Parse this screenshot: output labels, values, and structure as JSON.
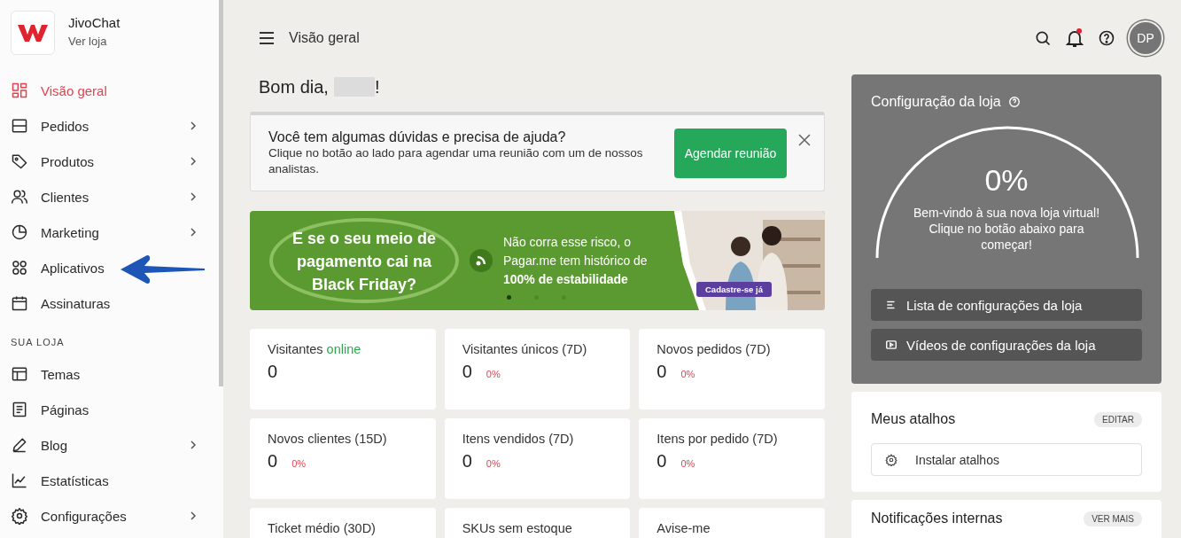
{
  "sidebar": {
    "store_name": "JivoChat",
    "store_link": "Ver loja",
    "items": [
      {
        "label": "Visão geral",
        "has_submenu": false,
        "selected": true
      },
      {
        "label": "Pedidos",
        "has_submenu": true,
        "selected": false
      },
      {
        "label": "Produtos",
        "has_submenu": true,
        "selected": false
      },
      {
        "label": "Clientes",
        "has_submenu": true,
        "selected": false
      },
      {
        "label": "Marketing",
        "has_submenu": true,
        "selected": false
      },
      {
        "label": "Aplicativos",
        "has_submenu": false,
        "selected": false
      },
      {
        "label": "Assinaturas",
        "has_submenu": false,
        "selected": false
      }
    ],
    "section_title": "SUA LOJA",
    "store_items": [
      {
        "label": "Temas",
        "has_submenu": false,
        "selected": false
      },
      {
        "label": "Páginas",
        "has_submenu": false,
        "selected": false
      },
      {
        "label": "Blog",
        "has_submenu": true,
        "selected": false
      },
      {
        "label": "Estatísticas",
        "has_submenu": false,
        "selected": false
      },
      {
        "label": "Configurações",
        "has_submenu": true,
        "selected": false
      }
    ]
  },
  "header": {
    "title": "Visão geral",
    "notification_dot": true,
    "avatar": "DP"
  },
  "greeting": {
    "text": "Bom dia,",
    "end": "!"
  },
  "help_banner": {
    "title": "Você tem algumas dúvidas e precisa de ajuda?",
    "text": "Clique no botão ao lado para agendar uma reunião com um de nossos analistas.",
    "button": "Agendar reunião"
  },
  "promo": {
    "headline": "E se o seu meio de pagamento cai na Black Friday?",
    "text": "Não corra esse risco, o Pagar.me tem histórico de **100% de estabilidade**",
    "cta": "Cadastre-se já",
    "slides": [
      {
        "selected": true
      },
      {
        "selected": false
      },
      {
        "selected": false
      }
    ]
  },
  "stats": [
    {
      "label": "Visitantes",
      "highlight": "online",
      "value": "0"
    },
    {
      "label": "Visitantes únicos (7D)",
      "value": "0",
      "change": "0%"
    },
    {
      "label": "Novos pedidos (7D)",
      "value": "0",
      "change": "0%"
    },
    {
      "label": "Novos clientes (15D)",
      "value": "0",
      "change": "0%"
    },
    {
      "label": "Itens vendidos (7D)",
      "value": "0",
      "change": "0%"
    },
    {
      "label": "Itens por pedido (7D)",
      "value": "0",
      "change": "0%"
    },
    {
      "label": "Ticket médio (30D)"
    },
    {
      "label": "SKUs sem estoque"
    },
    {
      "label": "Avise-me"
    }
  ],
  "setup": {
    "title": "Configuração da loja",
    "percent": "0%",
    "message": "Bem-vindo à sua nova loja virtual! Clique no botão abaixo para começar!",
    "buttons": [
      {
        "label": "Lista de configurações da loja"
      },
      {
        "label": "Vídeos de configurações da loja"
      }
    ]
  },
  "shortcuts": {
    "title": "Meus atalhos",
    "edit": "EDITAR",
    "install": "Instalar atalhos"
  },
  "notifications": {
    "title": "Notificações internas",
    "more": "VER MAIS"
  }
}
